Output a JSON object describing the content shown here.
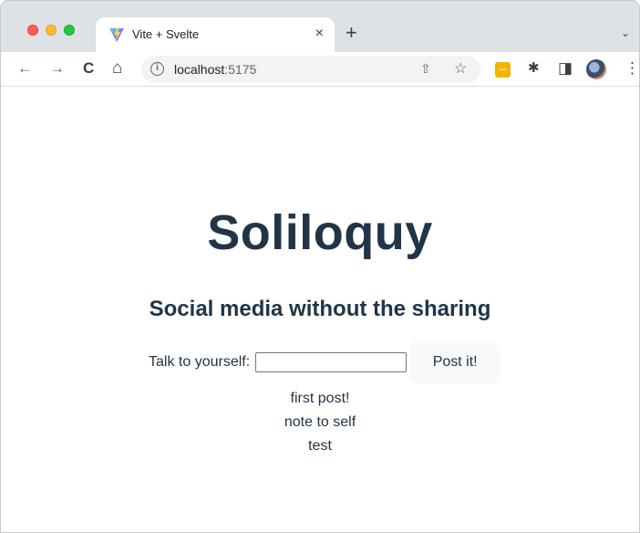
{
  "browser": {
    "tab": {
      "title": "Vite + Svelte",
      "close": "×",
      "favicon": "vite-logo-icon"
    },
    "new_tab": "+",
    "tab_menu": "⌄",
    "toolbar": {
      "back": "←",
      "forward": "→",
      "reload": "C",
      "home": "⌂",
      "info": "i",
      "url_host": "localhost",
      "url_port": ":5175",
      "share": "⇧",
      "bookmark": "☆",
      "extension": "...",
      "puzzle": "✱",
      "sidepanel": "◨",
      "menu": "⋮"
    }
  },
  "app": {
    "heading": "Soliloquy",
    "subheading": "Social media without the sharing",
    "form": {
      "label": "Talk to yourself:",
      "input_value": "",
      "button": "Post it!"
    },
    "posts": [
      "first post!",
      "note to self",
      "test"
    ]
  },
  "colors": {
    "text": "#213547",
    "tabstrip": "#dee1e6",
    "button_bg": "#f9f9f9"
  }
}
